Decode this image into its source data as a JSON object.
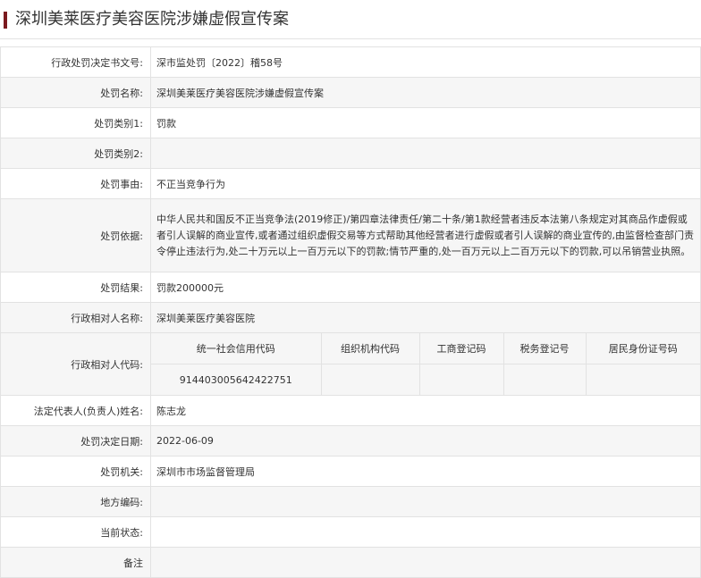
{
  "page": {
    "title": "深圳美莱医疗美容医院涉嫌虚假宣传案"
  },
  "colors": {
    "title_accent": "#7b1a1f",
    "row_alt_background": "#f6f6f6",
    "border": "#e2e2e2"
  },
  "fields": {
    "decision_no": {
      "label": "行政处罚决定书文号:",
      "value": "深市监处罚〔2022〕稽58号"
    },
    "penalty_name": {
      "label": "处罚名称:",
      "value": "深圳美莱医疗美容医院涉嫌虚假宣传案"
    },
    "category1": {
      "label": "处罚类别1:",
      "value": "罚款"
    },
    "category2": {
      "label": "处罚类别2:",
      "value": ""
    },
    "reason": {
      "label": "处罚事由:",
      "value": "不正当竞争行为"
    },
    "basis": {
      "label": "处罚依据:",
      "value": "中华人民共和国反不正当竞争法(2019修正)/第四章法律责任/第二十条/第1款经营者违反本法第八条规定对其商品作虚假或者引人误解的商业宣传,或者通过组织虚假交易等方式帮助其他经营者进行虚假或者引人误解的商业宣传的,由监督检查部门责令停止违法行为,处二十万元以上一百万元以下的罚款;情节严重的,处一百万元以上二百万元以下的罚款,可以吊销营业执照。"
    },
    "result": {
      "label": "处罚结果:",
      "value": "罚款200000元"
    },
    "party_name": {
      "label": "行政相对人名称:",
      "value": "深圳美莱医疗美容医院"
    },
    "party_codes": {
      "label": "行政相对人代码:",
      "headers": [
        "统一社会信用代码",
        "组织机构代码",
        "工商登记码",
        "税务登记号",
        "居民身份证号码"
      ],
      "values": [
        "914403005642422751",
        "",
        "",
        "",
        ""
      ]
    },
    "legal_rep": {
      "label": "法定代表人(负责人)姓名:",
      "value": "陈志龙"
    },
    "decision_date": {
      "label": "处罚决定日期:",
      "value": "2022-06-09"
    },
    "authority": {
      "label": "处罚机关:",
      "value": "深圳市市场监督管理局"
    },
    "region_code": {
      "label": "地方编码:",
      "value": ""
    },
    "current_status": {
      "label": "当前状态:",
      "value": ""
    },
    "remarks": {
      "label": "备注",
      "value": ""
    }
  }
}
